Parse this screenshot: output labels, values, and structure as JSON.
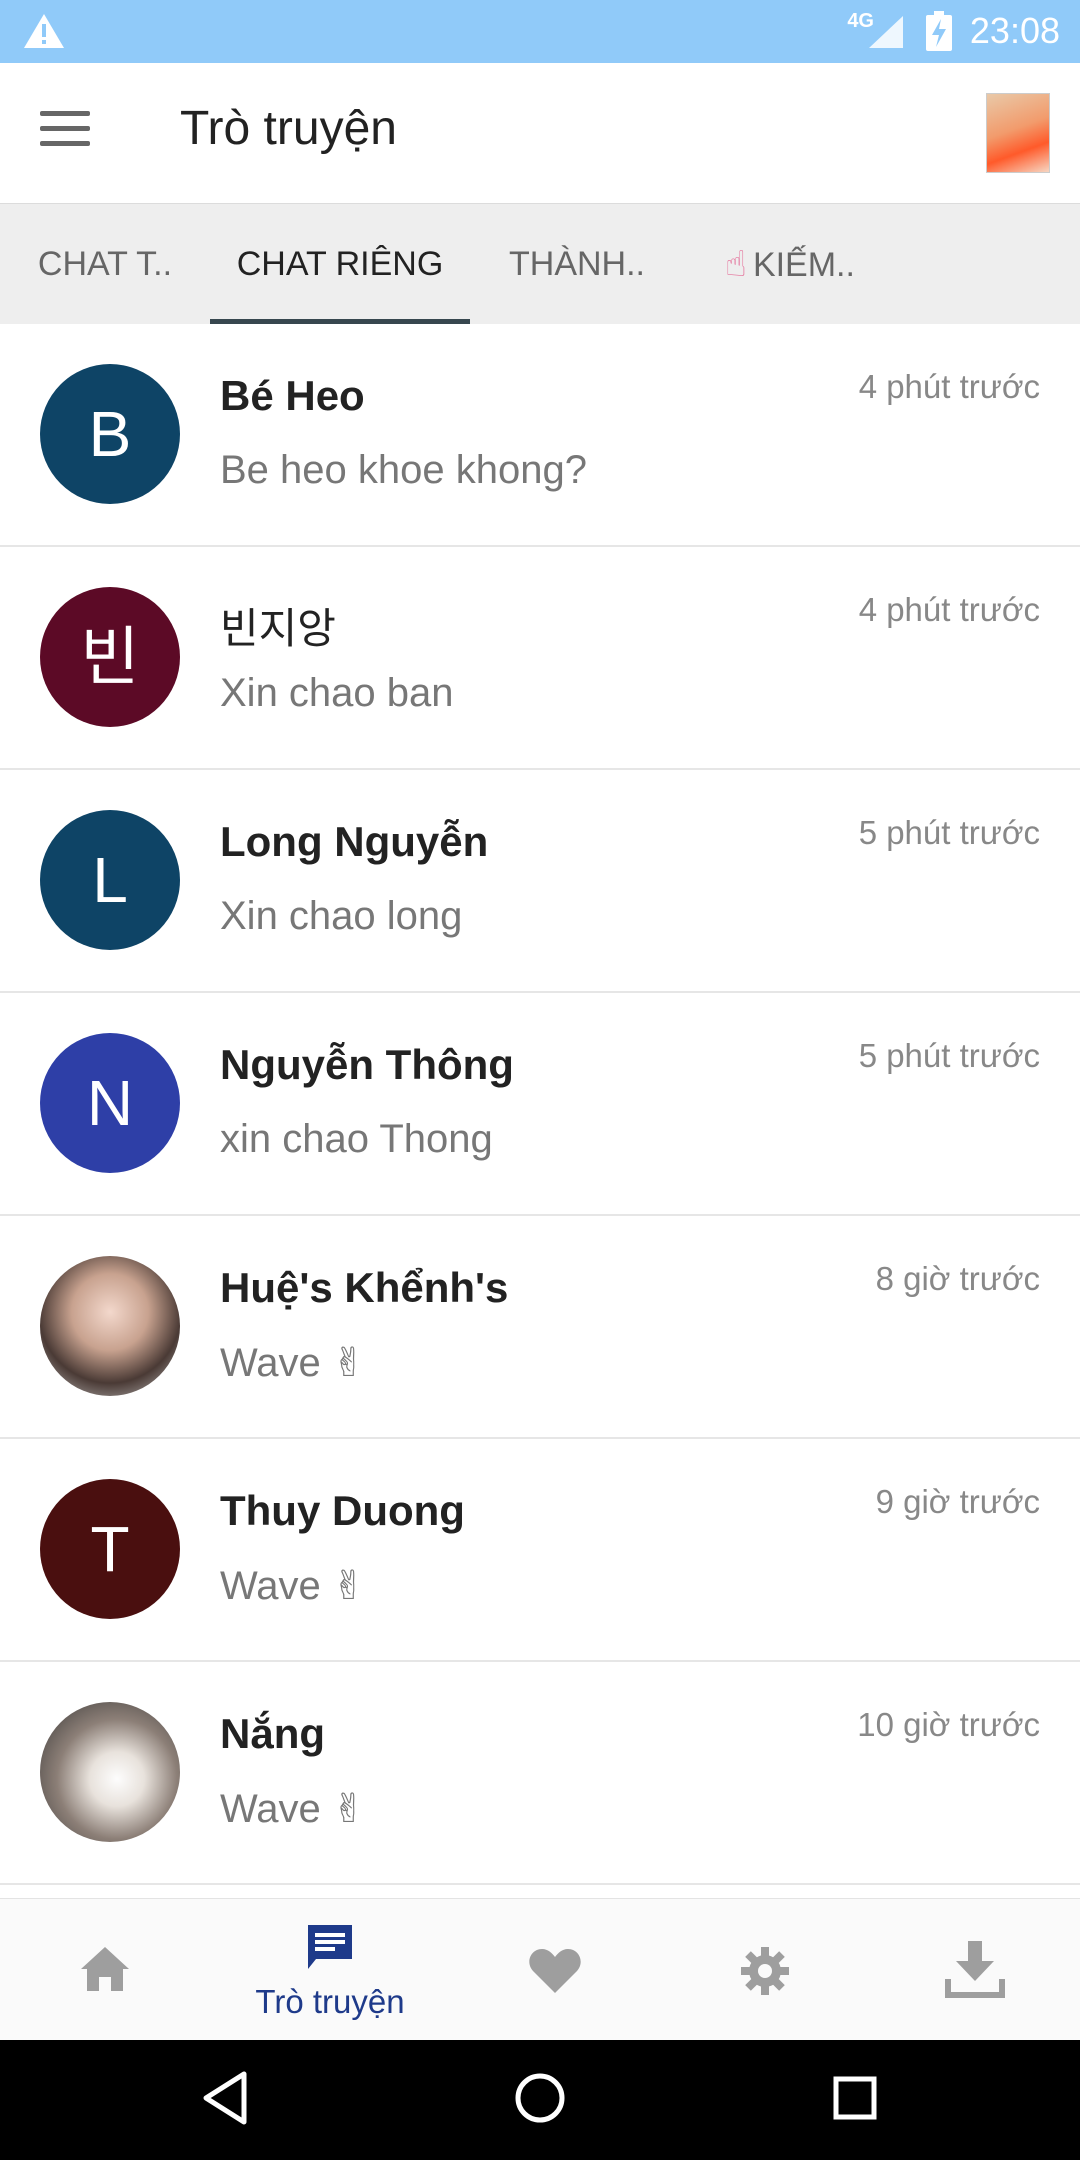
{
  "status_bar": {
    "network": "4G",
    "time": "23:08",
    "icons": [
      "warning-icon",
      "signal-icon",
      "battery-charging-icon"
    ]
  },
  "app_bar": {
    "title": "Trò truyện",
    "menu_icon": "hamburger-menu-icon"
  },
  "tabs": [
    {
      "label": "CHAT T.."
    },
    {
      "label": "CHAT RIÊNG"
    },
    {
      "label": "THÀNH.."
    },
    {
      "label": "KIẾM..",
      "icon": "☝"
    }
  ],
  "chats": [
    {
      "initial": "B",
      "name": "Bé Heo",
      "message": "Be heo khoe khong?",
      "time": "4 phút trước",
      "color": "#0e4466"
    },
    {
      "initial": "빈",
      "name": "빈지앙",
      "message": "Xin chao ban",
      "time": "4 phút trước",
      "color": "#5c0a26"
    },
    {
      "initial": "L",
      "name": "Long Nguyễn",
      "message": "Xin chao long",
      "time": "5 phút trước",
      "color": "#0e4466"
    },
    {
      "initial": "N",
      "name": "Nguyễn Thông",
      "message": "xin chao Thong",
      "time": "5 phút trước",
      "color": "#2e3fa7"
    },
    {
      "initial": "",
      "name": "Huệ's Khểnh's",
      "message": "Wave ✌",
      "time": "8 giờ trước",
      "color": "#cccccc"
    },
    {
      "initial": "T",
      "name": "Thuy Duong",
      "message": "Wave ✌",
      "time": "9 giờ trước",
      "color": "#4a0f0f"
    },
    {
      "initial": "",
      "name": "Nắng",
      "message": "Wave ✌",
      "time": "10 giờ trước",
      "color": "#cccccc"
    }
  ],
  "bottom_nav": {
    "items": [
      {
        "icon": "home-icon"
      },
      {
        "icon": "chat-icon",
        "label": "Trò truyện"
      },
      {
        "icon": "heart-icon"
      },
      {
        "icon": "settings-gear-icon"
      },
      {
        "icon": "download-icon"
      }
    ],
    "active_color": "#1e3a8a",
    "inactive_color": "#9e9e9e"
  }
}
